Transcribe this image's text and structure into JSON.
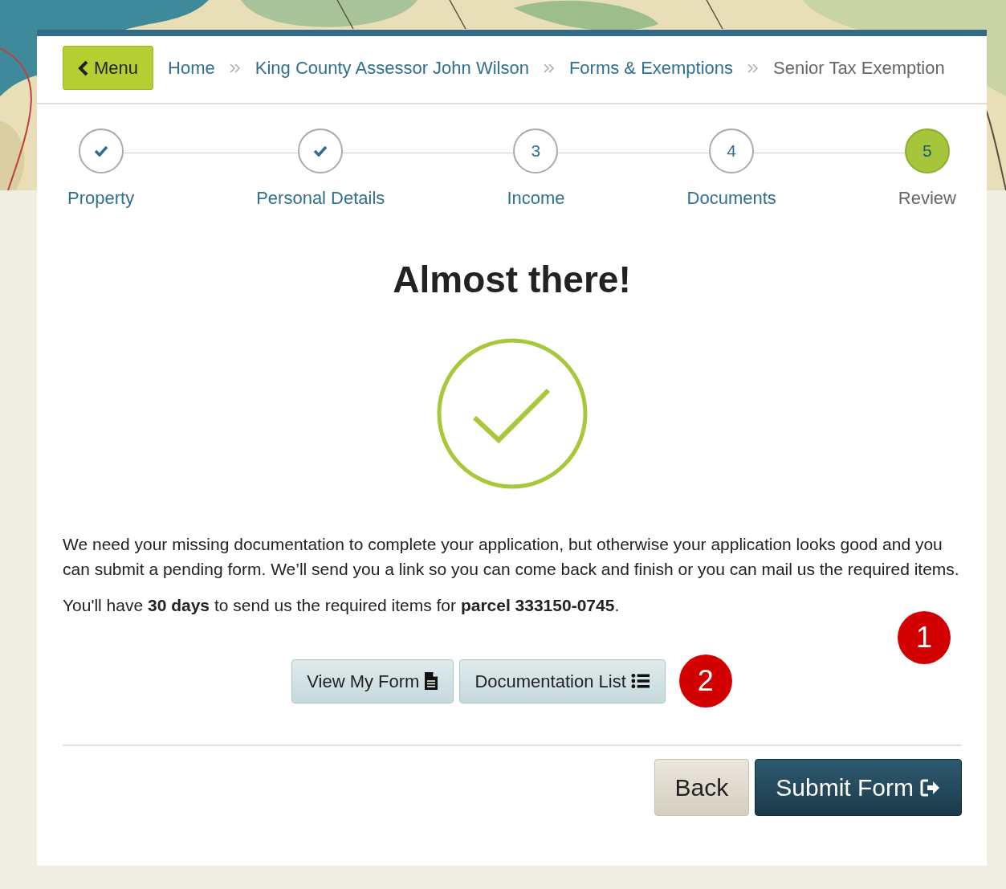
{
  "menu_button": {
    "label": "Menu"
  },
  "breadcrumbs": [
    {
      "label": "Home",
      "current": false
    },
    {
      "label": "King County Assessor John Wilson",
      "current": false
    },
    {
      "label": "Forms & Exemptions",
      "current": false
    },
    {
      "label": "Senior Tax Exemption",
      "current": true
    }
  ],
  "steps": [
    {
      "label": "Property",
      "completed": true,
      "selected": false
    },
    {
      "label": "Personal Details",
      "completed": true,
      "selected": false
    },
    {
      "label": "Income",
      "number": "3",
      "completed": false,
      "selected": false
    },
    {
      "label": "Documents",
      "number": "4",
      "completed": false,
      "selected": false
    },
    {
      "label": "Review",
      "number": "5",
      "completed": false,
      "selected": true
    }
  ],
  "heading": "Almost there!",
  "paragraphs": [
    "We need your missing documentation to complete your application, but otherwise your application looks good and you can submit a pending form. We’ll send you a link so you can come back and finish or you can mail us the required items.",
    "You'll have **30 days** to send us the required items for **parcel 333150-0745**."
  ],
  "action_buttons": [
    {
      "label": "View My Form",
      "kind": "document"
    },
    {
      "label": "Documentation List",
      "kind": "list"
    }
  ],
  "footer_buttons": [
    {
      "label": "Back",
      "kind": "secondary"
    },
    {
      "label": "Submit Form",
      "kind": "primary"
    }
  ],
  "callouts": [
    "1",
    "2"
  ]
}
